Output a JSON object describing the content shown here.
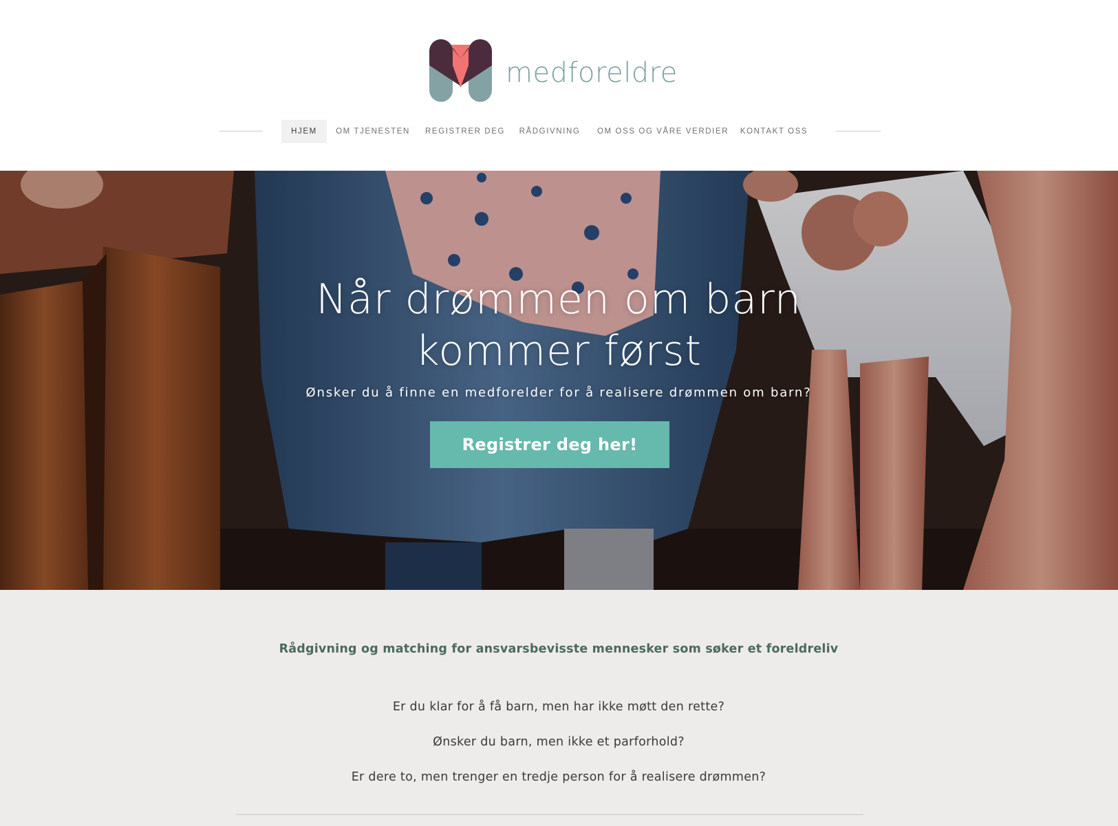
{
  "brand": {
    "name": "medforeldre",
    "colors": {
      "logo_dark": "#4a2c3d",
      "logo_coral": "#f27373",
      "logo_teal": "#84a2a4",
      "wordmark": "#7e9ea0"
    }
  },
  "nav": {
    "items": [
      {
        "label": "HJEM",
        "active": true
      },
      {
        "label": "OM TJENESTEN",
        "active": false
      },
      {
        "label": "REGISTRER DEG",
        "active": false
      },
      {
        "label": "RÅDGIVNING",
        "active": false
      },
      {
        "label": "OM OSS OG VÅRE VERDIER",
        "active": false
      },
      {
        "label": "KONTAKT OSS",
        "active": false
      }
    ]
  },
  "hero": {
    "title_line1": "Når drømmen om barn",
    "title_line2": "kommer først",
    "subtitle": "Ønsker du å finne en medforelder for å realisere drømmen om barn?",
    "cta_label": "Registrer deg her!",
    "cta_color": "#66b9ad"
  },
  "content": {
    "heading": "Rådgivning og matching for ansvarsbevisste mennesker som søker et foreldreliv",
    "paragraphs": [
      "Er du klar for å få barn, men har ikke møtt den rette?",
      "Ønsker du barn, men ikke et parforhold?",
      "Er dere to, men trenger en tredje person for å realisere drømmen?"
    ],
    "background": "#eeecea",
    "heading_color": "#4a6a60"
  }
}
